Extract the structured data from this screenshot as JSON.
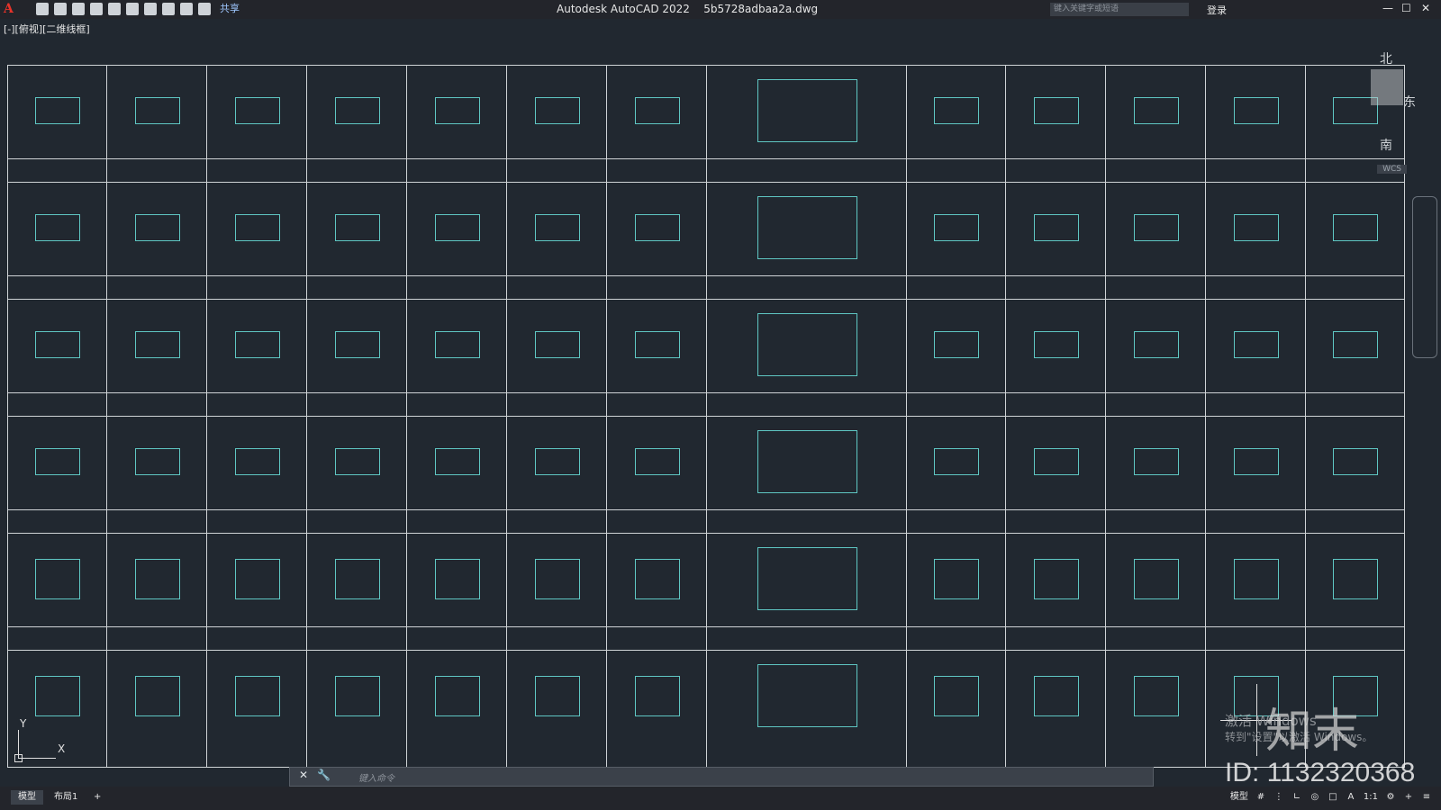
{
  "titlebar": {
    "app_title": "Autodesk AutoCAD 2022",
    "file_name": "5b5728adbaa2a.dwg",
    "share_label": "共享",
    "search_placeholder": "键入关键字或短语",
    "login_label": "登录"
  },
  "view_label": "[-][俯视][二维线框]",
  "viewcube": {
    "north": "北",
    "east": "东",
    "south": "南",
    "wcs": "WCS"
  },
  "ucs": {
    "x": "X",
    "y": "Y"
  },
  "command": {
    "placeholder": "键入命令"
  },
  "statusbar": {
    "tabs": [
      "模型",
      "布局1",
      "+"
    ],
    "model_label": "模型",
    "scale": "1:1"
  },
  "watermark": {
    "activate_line1": "激活 Windows",
    "activate_line2": "转到\"设置\"以激活 Windows。",
    "brand": "知末",
    "id": "ID: 1132320368"
  },
  "colors": {
    "background": "#212830",
    "grid_line": "#cfd3d6",
    "symbol": "#5fc7c3",
    "title_bar": "#23252b",
    "logo_red": "#e8332a"
  }
}
